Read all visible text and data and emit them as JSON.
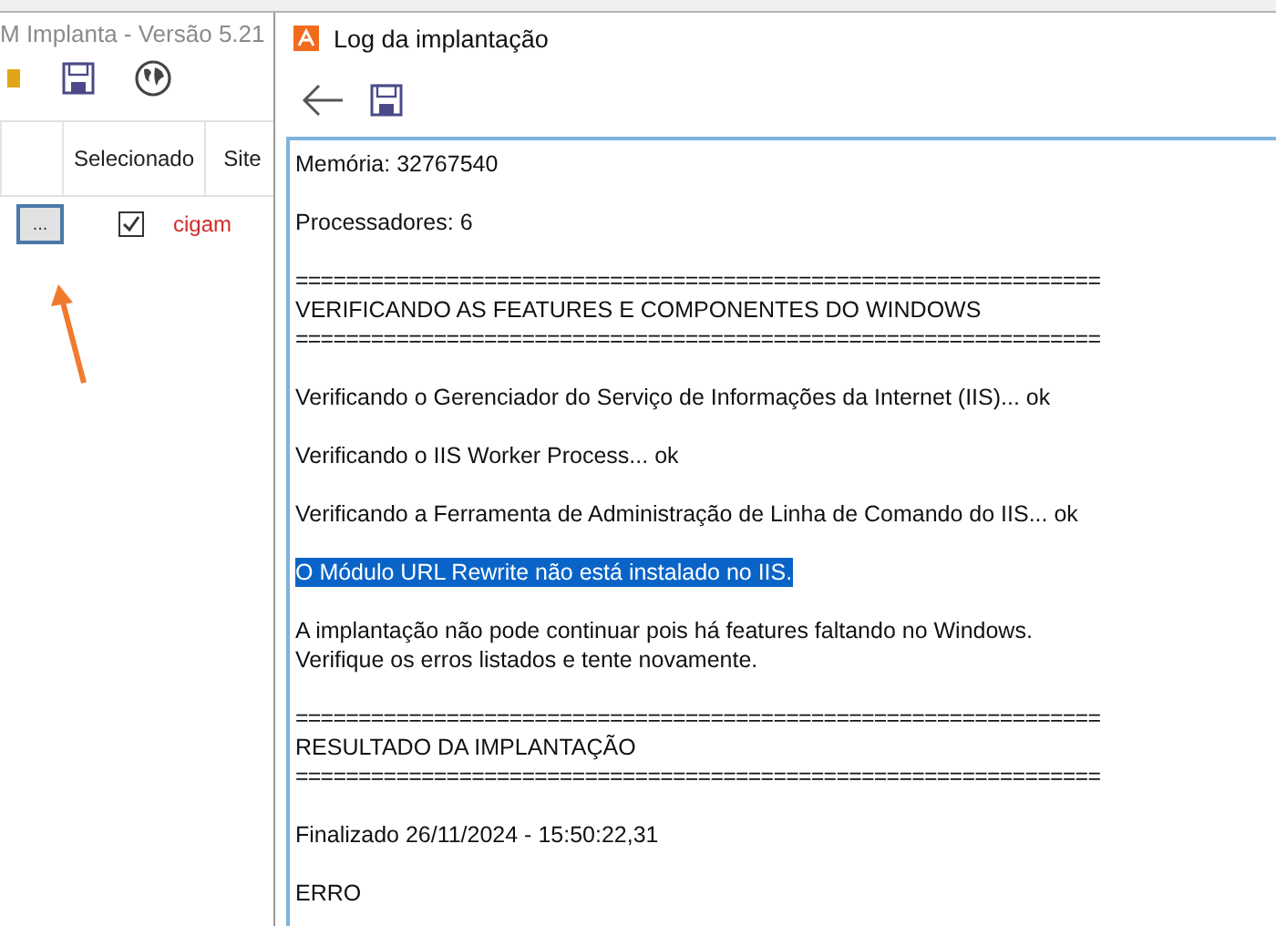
{
  "background_app": {
    "title": "M Implanta - Versão 5.21",
    "table": {
      "columns": [
        "Selecionado",
        "Site"
      ],
      "rows": [
        {
          "button": "...",
          "checked": true,
          "site": "cigam"
        }
      ]
    }
  },
  "dialog": {
    "title": "Log da implantação",
    "log": [
      [
        {
          "text": "Memória: 32767540",
          "selected": false
        }
      ],
      [
        {
          "text": "Processadores: 6",
          "selected": false
        }
      ],
      [
        {
          "text": "================================================================",
          "selected": false
        },
        {
          "text": "VERIFICANDO AS FEATURES E COMPONENTES DO WINDOWS",
          "selected": false
        },
        {
          "text": "================================================================",
          "selected": false
        }
      ],
      [
        {
          "text": "Verificando o Gerenciador do Serviço de Informações da Internet (IIS)... ok",
          "selected": false
        }
      ],
      [
        {
          "text": "Verificando o IIS Worker Process... ok",
          "selected": false
        }
      ],
      [
        {
          "text": "Verificando a Ferramenta de Administração de Linha de Comando do IIS... ok",
          "selected": false
        }
      ],
      [
        {
          "text": "O Módulo URL Rewrite não está instalado no IIS.",
          "selected": true
        }
      ],
      [
        {
          "text": "A implantação não pode continuar pois há features faltando no Windows.",
          "selected": false
        },
        {
          "text": "Verifique os erros listados e tente novamente.",
          "selected": false
        }
      ],
      [
        {
          "text": "================================================================",
          "selected": false
        },
        {
          "text": "RESULTADO DA IMPLANTAÇÃO",
          "selected": false
        },
        {
          "text": "================================================================",
          "selected": false
        }
      ],
      [
        {
          "text": "Finalizado 26/11/2024 - 15:50:22,31",
          "selected": false
        }
      ],
      [
        {
          "text": "ERRO",
          "selected": false
        }
      ]
    ]
  }
}
